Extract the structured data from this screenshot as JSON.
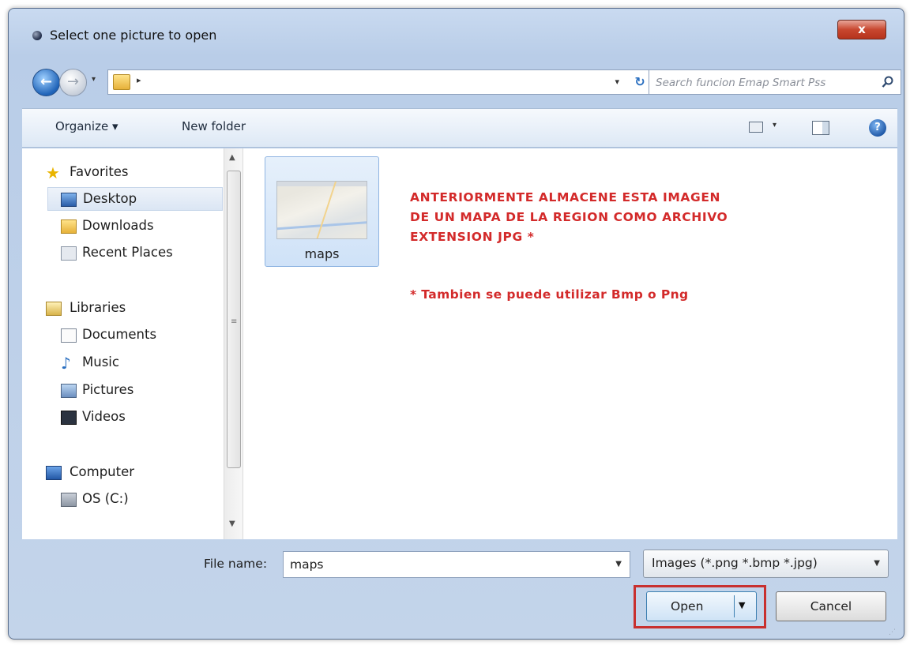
{
  "window": {
    "title": "Select one picture to open",
    "close_label": "x"
  },
  "navigation": {
    "search_placeholder": "Search funcion Emap Smart Pss"
  },
  "toolbar": {
    "organize_label": "Organize ▾",
    "new_folder_label": "New folder"
  },
  "sidebar": {
    "favorites": {
      "label": "Favorites",
      "items": [
        {
          "label": "Desktop",
          "selected": true
        },
        {
          "label": "Downloads"
        },
        {
          "label": "Recent Places"
        }
      ]
    },
    "libraries": {
      "label": "Libraries",
      "items": [
        {
          "label": "Documents"
        },
        {
          "label": "Music"
        },
        {
          "label": "Pictures"
        },
        {
          "label": "Videos"
        }
      ]
    },
    "computer": {
      "label": "Computer",
      "items": [
        {
          "label": "OS (C:)"
        }
      ]
    }
  },
  "files": [
    {
      "name": "maps",
      "selected": true
    }
  ],
  "annotation": {
    "lines": [
      "ANTERIORMENTE ALMACENE ESTA IMAGEN",
      "DE UN MAPA DE LA REGION COMO ARCHIVO",
      "EXTENSION JPG *"
    ],
    "note": "* Tambien se puede utilizar Bmp o Png",
    "color": "#d32a2a"
  },
  "footer": {
    "file_name_label": "File name:",
    "file_name_value": "maps",
    "file_type_value": "Images (*.png *.bmp *.jpg)",
    "open_label": "Open",
    "cancel_label": "Cancel",
    "highlight_color": "#c8302f"
  }
}
